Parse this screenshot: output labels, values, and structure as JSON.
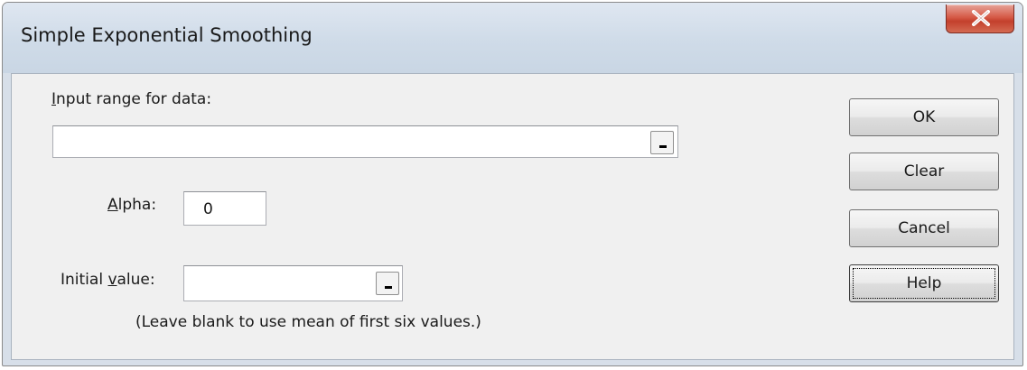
{
  "window": {
    "title": "Simple Exponential Smoothing",
    "close_icon": "close-x-icon"
  },
  "form": {
    "input_range": {
      "label_first": "I",
      "label_rest": "nput range for data:",
      "value": ""
    },
    "alpha": {
      "label_first": "A",
      "label_rest": "lpha:",
      "value": "0"
    },
    "initial_value": {
      "label_prefix": "Initial ",
      "label_underlined": "v",
      "label_rest": "alue:",
      "value": "",
      "note": "(Leave blank to use mean of first six values.)"
    }
  },
  "buttons": {
    "ok": "OK",
    "clear": "Clear",
    "cancel": "Cancel",
    "help": "Help"
  },
  "colors": {
    "frame": "#d7dfe9",
    "client": "#f0f0f0",
    "close_button": "#c3402c"
  }
}
